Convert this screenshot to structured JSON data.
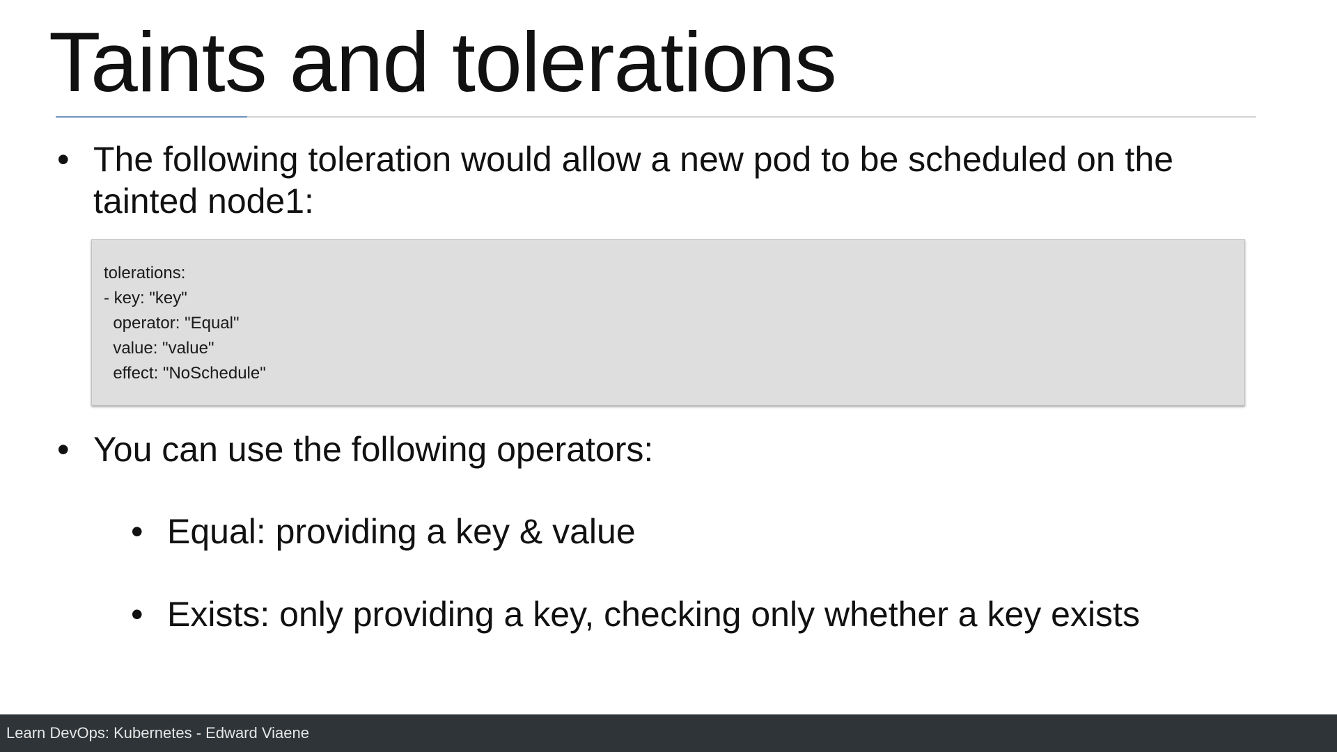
{
  "slide": {
    "title": "Taints and tolerations",
    "bullets": [
      "The following toleration would allow a new pod to be scheduled on the tainted node1:",
      "You can use the following operators:"
    ],
    "sub_bullets": [
      "Equal: providing a key & value",
      "Exists: only providing a key, checking only whether a key exists"
    ],
    "bullet_glyph": "•",
    "code_lines": [
      "tolerations:",
      "- key: \"key\"",
      "  operator: \"Equal\"",
      "  value: \"value\"",
      "  effect: \"NoSchedule\""
    ]
  },
  "footer": {
    "text": "Learn DevOps: Kubernetes - Edward Viaene"
  },
  "colors": {
    "background": "#ffffff",
    "title_rule": "#d2d2d2",
    "title_rule_accent": "#6e92bd",
    "code_background": "#dededf",
    "footer_background": "#2e3438",
    "footer_text": "#e6e6e6"
  }
}
